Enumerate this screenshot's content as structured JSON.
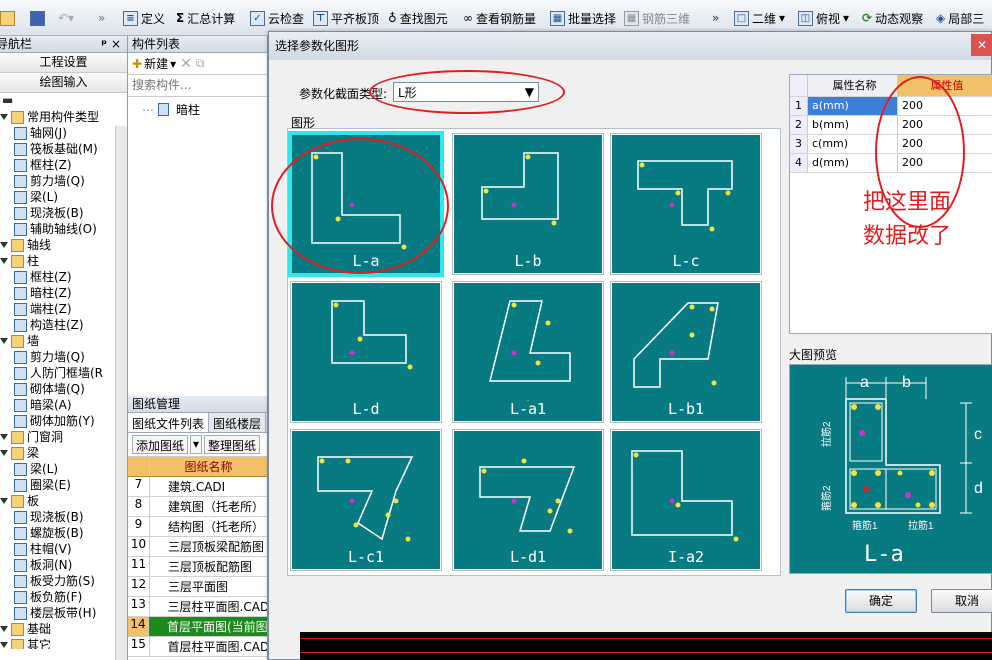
{
  "toolbar": {
    "items": [
      {
        "label": "定义",
        "icon": "define-icon"
      },
      {
        "label": "汇总计算",
        "icon": "sum-icon"
      },
      {
        "label": "云检查",
        "icon": "cloud-check-icon"
      },
      {
        "label": "平齐板顶",
        "icon": "align-slab-icon"
      },
      {
        "label": "查找图元",
        "icon": "find-icon"
      },
      {
        "label": "查看钢筋量",
        "icon": "rebar-qty-icon"
      },
      {
        "label": "批量选择",
        "icon": "batch-select-icon"
      },
      {
        "label": "钢筋三维",
        "icon": "rebar-3d-icon"
      },
      {
        "label": "二维",
        "icon": "2d-icon"
      },
      {
        "label": "俯视",
        "icon": "top-view-icon"
      },
      {
        "label": "动态观察",
        "icon": "orbit-icon"
      },
      {
        "label": "局部三",
        "icon": "local-3d-icon"
      }
    ],
    "more": "»"
  },
  "nav": {
    "title": "导航栏",
    "pin": "ᵖ",
    "close": "×",
    "buttons": [
      "工程设置",
      "绘图输入"
    ],
    "tree": [
      {
        "label": "常用构件类型",
        "level": 0,
        "group": true
      },
      {
        "label": "轴网(J)",
        "level": 1
      },
      {
        "label": "筏板基础(M)",
        "level": 1
      },
      {
        "label": "框柱(Z)",
        "level": 1
      },
      {
        "label": "剪力墙(Q)",
        "level": 1
      },
      {
        "label": "梁(L)",
        "level": 1
      },
      {
        "label": "现浇板(B)",
        "level": 1
      },
      {
        "label": "辅助轴线(O)",
        "level": 1
      },
      {
        "label": "轴线",
        "level": 0,
        "group": true
      },
      {
        "label": "柱",
        "level": 0,
        "group": true
      },
      {
        "label": "框柱(Z)",
        "level": 1
      },
      {
        "label": "暗柱(Z)",
        "level": 1
      },
      {
        "label": "端柱(Z)",
        "level": 1
      },
      {
        "label": "构造柱(Z)",
        "level": 1
      },
      {
        "label": "墙",
        "level": 0,
        "group": true
      },
      {
        "label": "剪力墙(Q)",
        "level": 1
      },
      {
        "label": "人防门框墙(R",
        "level": 1
      },
      {
        "label": "砌体墙(Q)",
        "level": 1
      },
      {
        "label": "暗梁(A)",
        "level": 1
      },
      {
        "label": "砌体加筋(Y)",
        "level": 1
      },
      {
        "label": "门窗洞",
        "level": 0,
        "group": true
      },
      {
        "label": "梁",
        "level": 0,
        "group": true
      },
      {
        "label": "梁(L)",
        "level": 1
      },
      {
        "label": "圈梁(E)",
        "level": 1
      },
      {
        "label": "板",
        "level": 0,
        "group": true
      },
      {
        "label": "现浇板(B)",
        "level": 1
      },
      {
        "label": "螺旋板(B)",
        "level": 1
      },
      {
        "label": "柱帽(V)",
        "level": 1
      },
      {
        "label": "板洞(N)",
        "level": 1
      },
      {
        "label": "板受力筋(S)",
        "level": 1
      },
      {
        "label": "板负筋(F)",
        "level": 1
      },
      {
        "label": "楼层板带(H)",
        "level": 1
      },
      {
        "label": "基础",
        "level": 0,
        "group": true
      },
      {
        "label": "其它",
        "level": 0,
        "group": true
      }
    ]
  },
  "member": {
    "title": "构件列表",
    "new_label": "新建",
    "search_placeholder": "搜索构件...",
    "items": [
      "暗柱"
    ]
  },
  "drawing": {
    "title": "图纸管理",
    "tabs": [
      "图纸文件列表",
      "图纸楼层"
    ],
    "add_label": "添加图纸",
    "arrange_label": "整理图纸",
    "col_header": "图纸名称",
    "rows": [
      {
        "n": "7",
        "name": "建筑.CADI"
      },
      {
        "n": "8",
        "name": "建筑图（托老所）"
      },
      {
        "n": "9",
        "name": "结构图（托老所）"
      },
      {
        "n": "10",
        "name": "三层顶板梁配筋图"
      },
      {
        "n": "11",
        "name": "三层顶板配筋图"
      },
      {
        "n": "12",
        "name": "三层平面图"
      },
      {
        "n": "13",
        "name": "三层柱平面图.CAD"
      },
      {
        "n": "14",
        "name": "首层平面图(当前图)",
        "selected": true
      },
      {
        "n": "15",
        "name": "首层柱平面图.CAD"
      }
    ]
  },
  "dialog": {
    "title": "选择参数化图形",
    "close": "✕",
    "type_label": "参数化截面类型:",
    "type_value": "L形",
    "shapes_label": "图形",
    "shapes": [
      "L-a",
      "L-b",
      "L-c",
      "L-d",
      "L-a1",
      "L-b1",
      "L-c1",
      "L-d1",
      "I-a2"
    ],
    "selected_shape": "L-a",
    "props_headers": [
      "属性名称",
      "属性值"
    ],
    "props": [
      {
        "n": "1",
        "name": "a(mm)",
        "value": "200"
      },
      {
        "n": "2",
        "name": "b(mm)",
        "value": "200"
      },
      {
        "n": "3",
        "name": "c(mm)",
        "value": "200"
      },
      {
        "n": "4",
        "name": "d(mm)",
        "value": "200"
      }
    ],
    "annotation": [
      "把这里面",
      "数据改了"
    ],
    "preview_label": "大图预览",
    "preview_shape": "L-a",
    "preview_texts": {
      "a": "a",
      "b": "b",
      "c": "c",
      "d": "d",
      "lj2": "拉筋2",
      "gj2": "箍筋2",
      "gj1": "箍筋1",
      "lj1": "拉筋1"
    },
    "ok_label": "确定",
    "cancel_label": "取消"
  },
  "colors": {
    "teal": "#087a82",
    "accent_red": "#e02020",
    "rebar_yellow": "#f2e43a",
    "selected_row": "#1e8a1e"
  }
}
